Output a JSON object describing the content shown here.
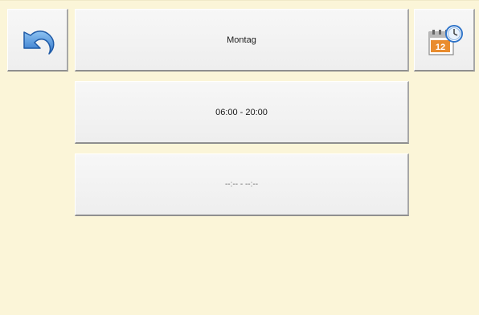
{
  "header": {
    "back_icon": "undo-arrow-icon",
    "day_label": "Montag",
    "calendar_icon": "calendar-clock-icon",
    "calendar_badge": "12"
  },
  "time_slots": [
    {
      "label": "06:00 - 20:00"
    },
    {
      "label": "--:-- - --:--"
    }
  ],
  "colors": {
    "background": "#fbf5d8",
    "button_face": "#f0f0f0",
    "icon_blue": "#4a8fd8",
    "calendar_orange": "#e98c2e"
  }
}
